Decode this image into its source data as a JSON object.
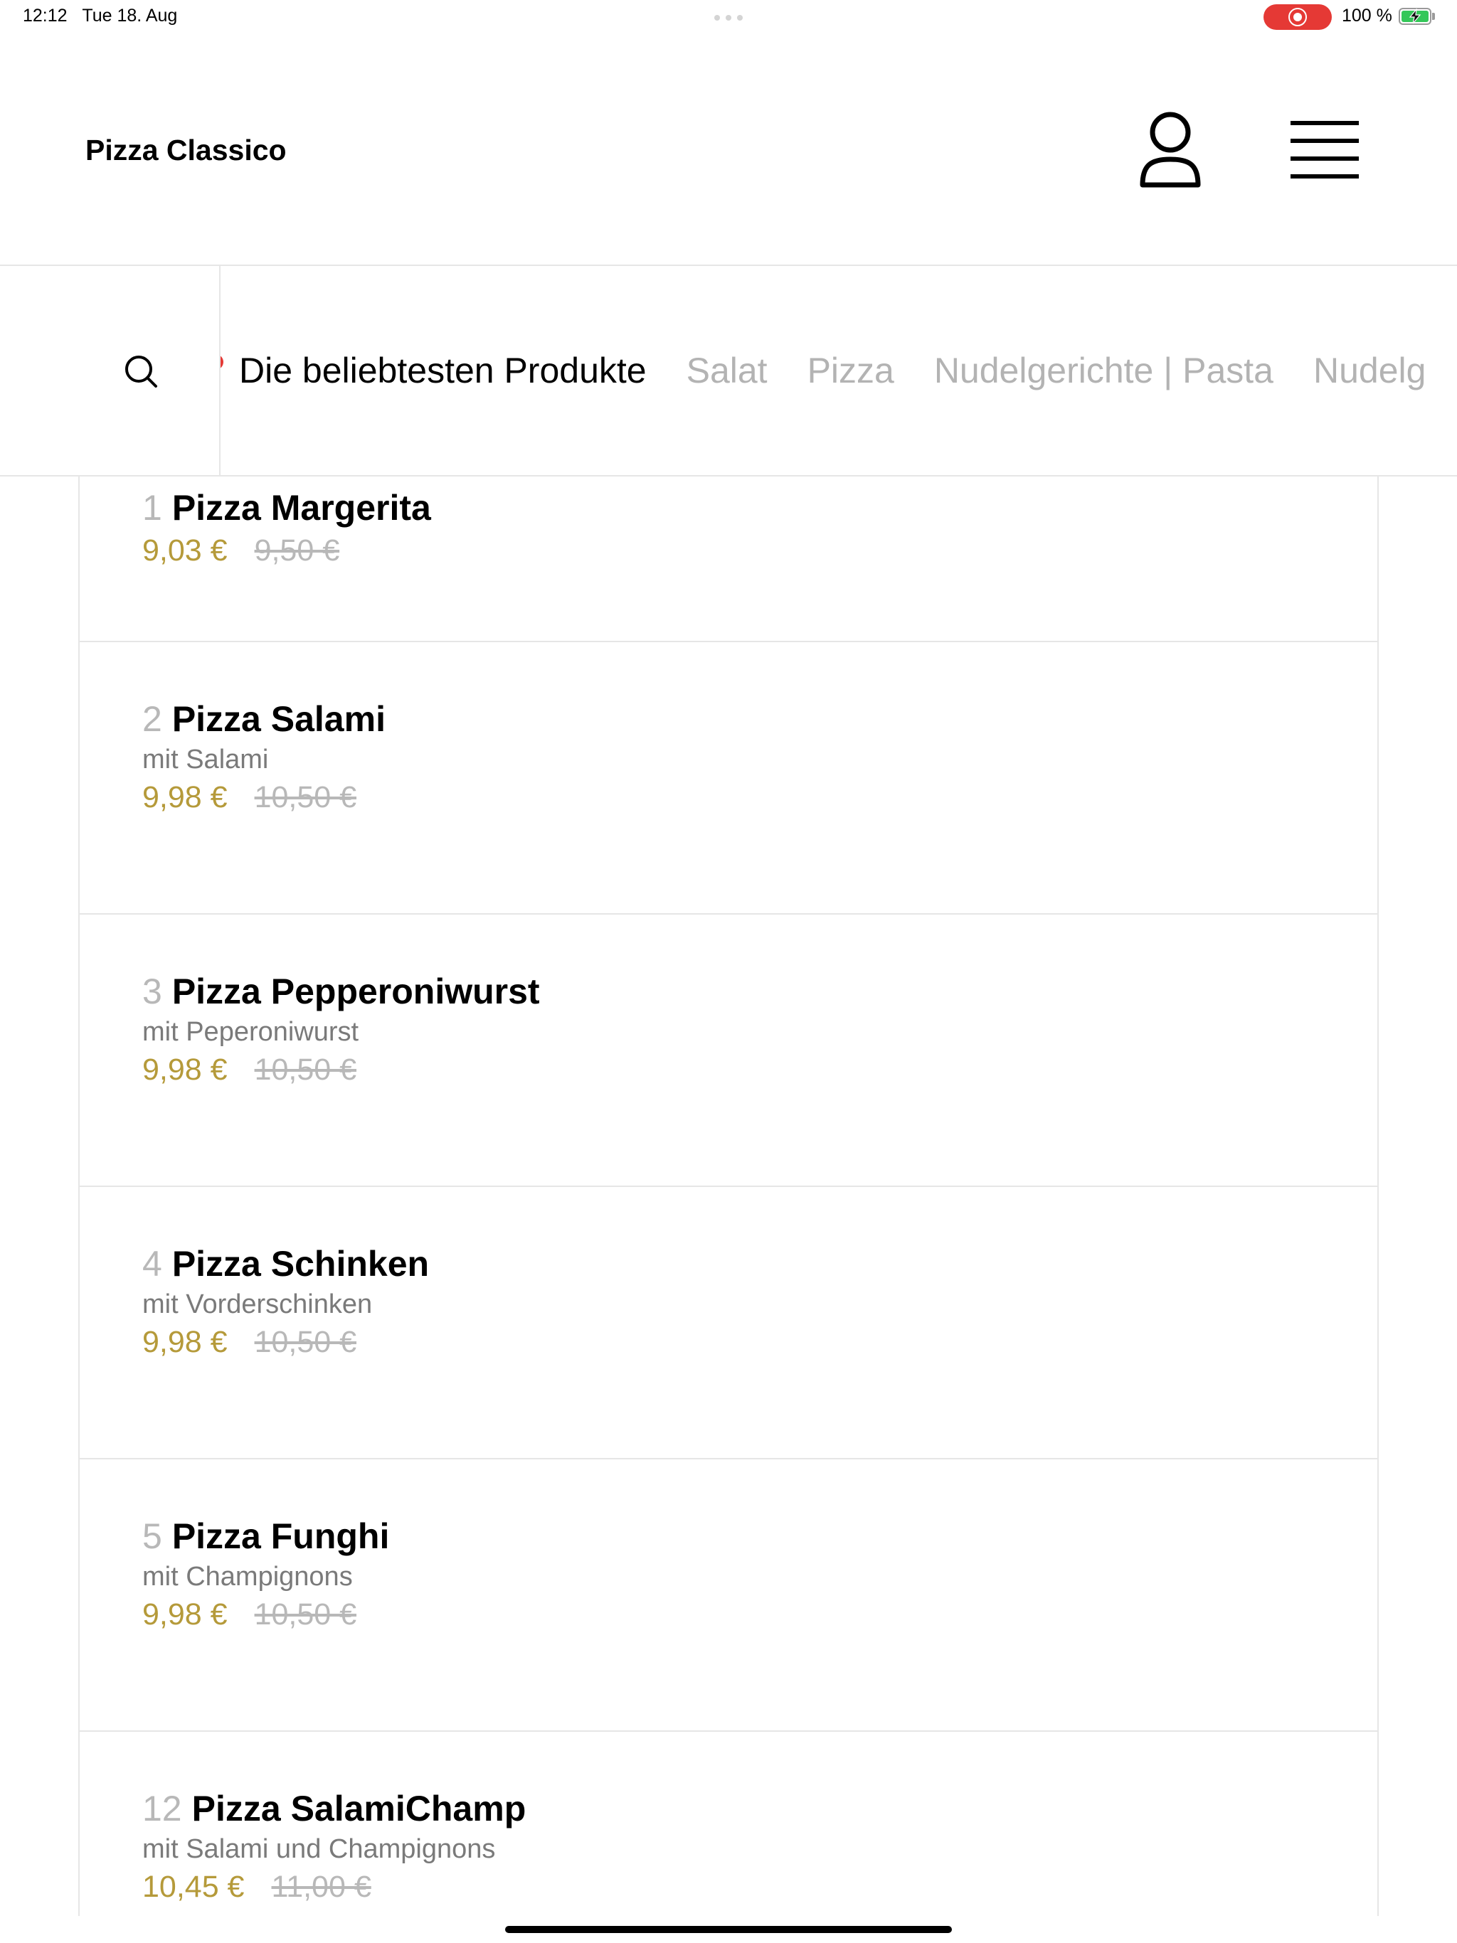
{
  "status_bar": {
    "time": "12:12",
    "date": "Tue 18. Aug",
    "battery": "100 %"
  },
  "header": {
    "title": "Pizza Classico"
  },
  "categories": {
    "tabs": [
      "Die beliebtesten Produkte",
      "Salat",
      "Pizza",
      "Nudelgerichte | Pasta",
      "Nudelg"
    ],
    "active_index": 0
  },
  "products": [
    {
      "number": "1",
      "name": "Pizza Margerita",
      "description": "",
      "price": "9,03 €",
      "old_price": "9,50 €"
    },
    {
      "number": "2",
      "name": "Pizza Salami",
      "description": "mit Salami",
      "price": "9,98 €",
      "old_price": "10,50 €"
    },
    {
      "number": "3",
      "name": "Pizza Pepperoniwurst",
      "description": "mit Peperoniwurst",
      "price": "9,98 €",
      "old_price": "10,50 €"
    },
    {
      "number": "4",
      "name": "Pizza Schinken",
      "description": "mit Vorderschinken",
      "price": "9,98 €",
      "old_price": "10,50 €"
    },
    {
      "number": "5",
      "name": "Pizza Funghi",
      "description": "mit Champignons",
      "price": "9,98 €",
      "old_price": "10,50 €"
    },
    {
      "number": "12",
      "name": "Pizza SalamiChamp",
      "description": "mit Salami und Champignons",
      "price": "10,45 €",
      "old_price": "11,00 €"
    }
  ],
  "colors": {
    "accent_price": "#b59a3a",
    "marker_red": "#e53935",
    "inactive_tab": "#b3b3b3",
    "battery_green": "#34c759"
  },
  "icons": {
    "user": "user-icon",
    "menu": "hamburger-menu-icon",
    "search": "search-icon"
  }
}
